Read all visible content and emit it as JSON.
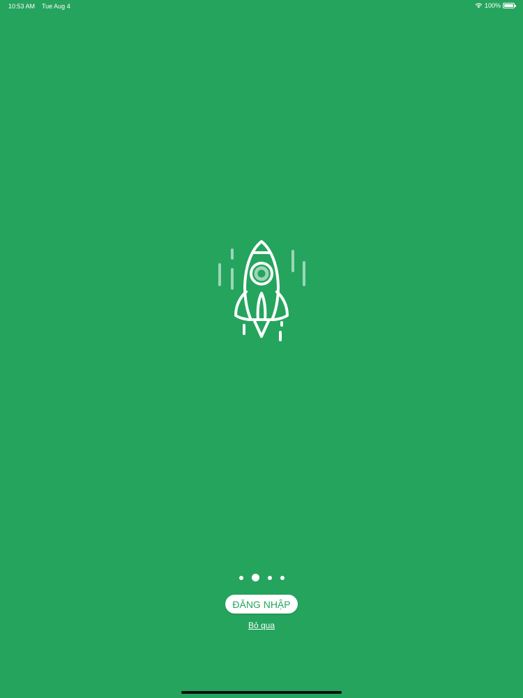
{
  "status_bar": {
    "time": "10:53 AM",
    "date": "Tue Aug 4",
    "battery_percent": "100%",
    "wifi_icon": "wifi-icon",
    "battery_icon": "battery-icon"
  },
  "hero": {
    "icon": "rocket-icon"
  },
  "pager": {
    "page_count": 4,
    "active_index": 1
  },
  "actions": {
    "login_label": "ĐĂNG NHẬP",
    "skip_label": "Bỏ qua"
  },
  "colors": {
    "background": "#25a45e",
    "button_bg": "#ffffff",
    "button_text": "#25a45e"
  }
}
